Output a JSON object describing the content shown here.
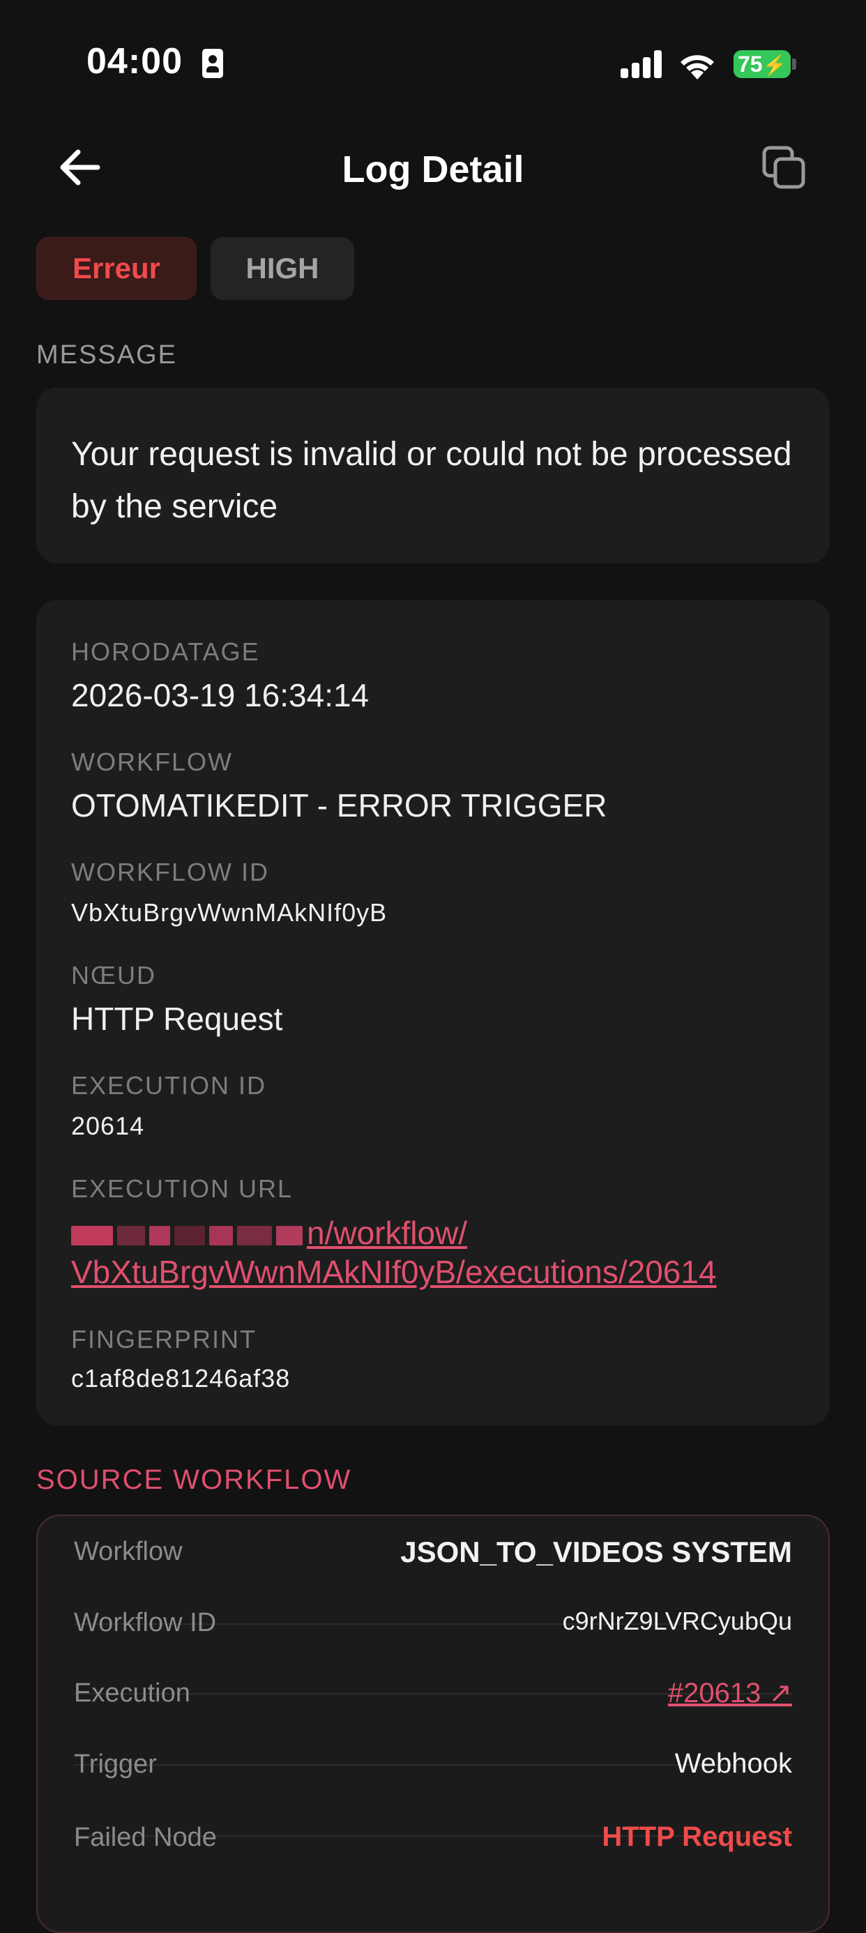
{
  "status_bar": {
    "time": "04:00",
    "battery": "75"
  },
  "header": {
    "title": "Log Detail"
  },
  "badges": {
    "level": "Erreur",
    "priority": "HIGH"
  },
  "message": {
    "label": "MESSAGE",
    "text": "Your request is invalid or could not be processed by the service"
  },
  "details": {
    "timestamp_label": "HORODATAGE",
    "timestamp": "2026-03-19 16:34:14",
    "workflow_label": "WORKFLOW",
    "workflow": "OTOMATIKEDIT - ERROR TRIGGER",
    "workflow_id_label": "WORKFLOW ID",
    "workflow_id": "VbXtuBrgvWwnMAkNIf0yB",
    "node_label": "NŒUD",
    "node": "HTTP Request",
    "execution_id_label": "EXECUTION ID",
    "execution_id": "20614",
    "execution_url_label": "EXECUTION URL",
    "execution_url_line1": "n/workflow/",
    "execution_url_line2": "VbXtuBrgvWwnMAkNIf0yB/executions/20614",
    "fingerprint_label": "FINGERPRINT",
    "fingerprint": "c1af8de81246af38"
  },
  "source_workflow": {
    "label": "SOURCE WORKFLOW",
    "rows": [
      {
        "key": "Workflow",
        "value": "JSON_TO_VIDEOS SYSTEM"
      },
      {
        "key": "Workflow ID",
        "value": "c9rNrZ9LVRCyubQu"
      },
      {
        "key": "Execution",
        "value": "#20613 ↗"
      },
      {
        "key": "Trigger",
        "value": "Webhook"
      },
      {
        "key": "Failed Node",
        "value": "HTTP Request"
      }
    ]
  },
  "colors": {
    "background": "#121212",
    "card": "#1d1d1d",
    "error": "#ef4b4b",
    "accent_pink": "#e0506e",
    "battery_green": "#34c759"
  }
}
